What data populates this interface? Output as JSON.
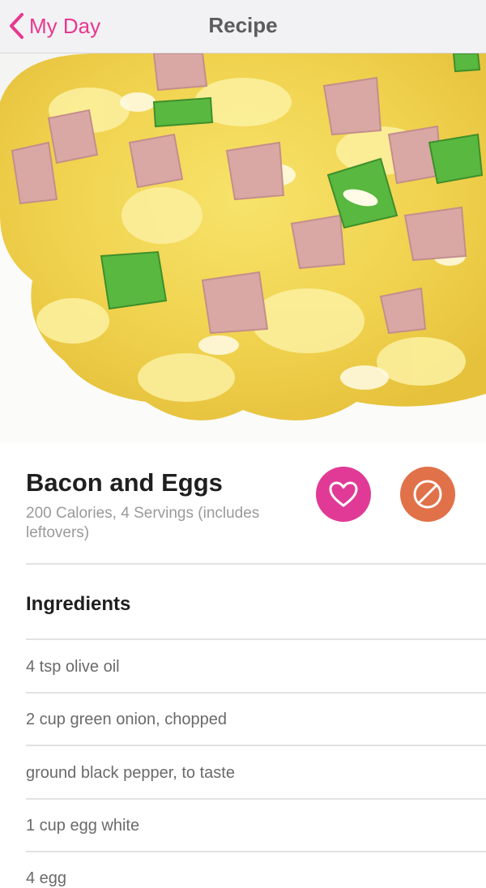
{
  "navbar": {
    "back_label": "My Day",
    "title": "Recipe",
    "accent": "#e8388f"
  },
  "recipe": {
    "title": "Bacon and Eggs",
    "subtitle": "200 Calories, 4 Servings (includes leftovers)",
    "favorite_icon": "heart-icon",
    "favorite_color": "#e03a96",
    "dislike_icon": "prohibited-icon",
    "dislike_color": "#e07149"
  },
  "ingredients": {
    "heading": "Ingredients",
    "items": [
      "4 tsp olive oil",
      "2 cup green onion, chopped",
      "ground black pepper, to taste",
      "1 cup egg white",
      "4 egg"
    ]
  }
}
